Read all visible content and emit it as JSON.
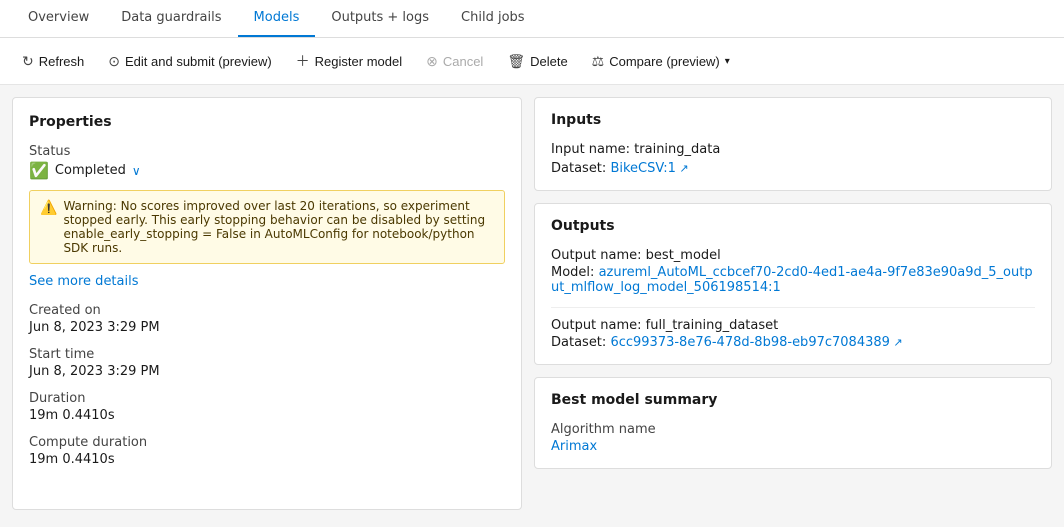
{
  "tabs": [
    {
      "id": "overview",
      "label": "Overview",
      "active": false
    },
    {
      "id": "data-guardrails",
      "label": "Data guardrails",
      "active": false
    },
    {
      "id": "models",
      "label": "Models",
      "active": true
    },
    {
      "id": "outputs-logs",
      "label": "Outputs + logs",
      "active": false
    },
    {
      "id": "child-jobs",
      "label": "Child jobs",
      "active": false
    }
  ],
  "toolbar": {
    "refresh": "Refresh",
    "edit_submit": "Edit and submit (preview)",
    "register_model": "Register model",
    "cancel": "Cancel",
    "delete": "Delete",
    "compare": "Compare (preview)"
  },
  "properties": {
    "title": "Properties",
    "status_label": "Status",
    "status_value": "Completed",
    "warning_text": "Warning: No scores improved over last 20 iterations, so experiment stopped early. This early stopping behavior can be disabled by setting enable_early_stopping = False in AutoMLConfig for notebook/python SDK runs.",
    "see_more": "See more details",
    "created_on_label": "Created on",
    "created_on_value": "Jun 8, 2023 3:29 PM",
    "start_time_label": "Start time",
    "start_time_value": "Jun 8, 2023 3:29 PM",
    "duration_label": "Duration",
    "duration_value": "19m 0.4410s",
    "compute_duration_label": "Compute duration",
    "compute_duration_value": "19m 0.4410s"
  },
  "inputs": {
    "title": "Inputs",
    "input_name_label": "Input name: training_data",
    "dataset_label": "Dataset:",
    "dataset_link": "BikeCSV:1"
  },
  "outputs": {
    "title": "Outputs",
    "output1_name": "Output name: best_model",
    "model_label": "Model:",
    "model_link": "azureml_AutoML_ccbcef70-2cd0-4ed1-ae4a-9f7e83e90a9d_5_output_mlflow_log_model_506198514:1",
    "output2_name": "Output name: full_training_dataset",
    "dataset_label2": "Dataset:",
    "dataset_link2": "6cc99373-8e76-478d-8b98-eb97c7084389"
  },
  "best_model": {
    "title": "Best model summary",
    "algorithm_label": "Algorithm name",
    "algorithm_link": "Arimax"
  }
}
